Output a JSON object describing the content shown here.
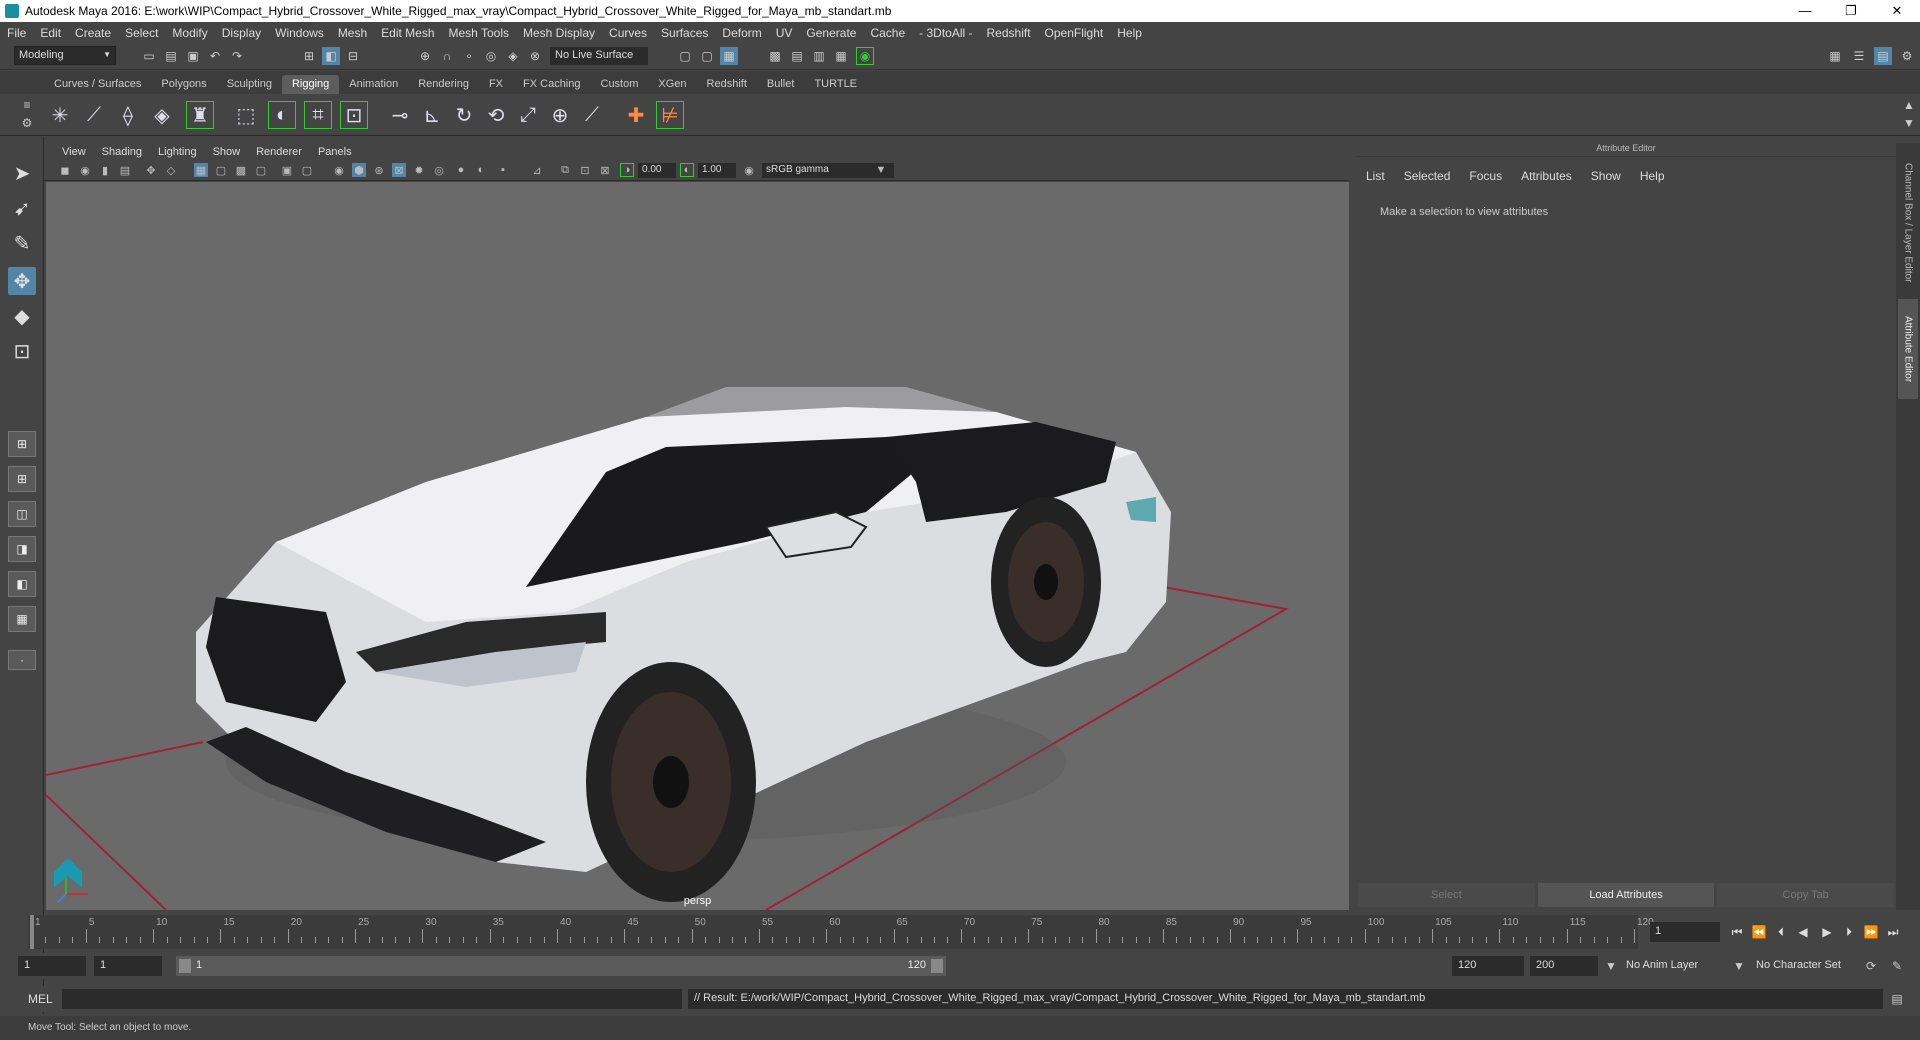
{
  "window": {
    "title": "Autodesk Maya 2016: E:\\work\\WIP\\Compact_Hybrid_Crossover_White_Rigged_max_vray\\Compact_Hybrid_Crossover_White_Rigged_for_Maya_mb_standart.mb",
    "controls": [
      "—",
      "❐",
      "✕"
    ]
  },
  "menu": [
    "File",
    "Edit",
    "Create",
    "Select",
    "Modify",
    "Display",
    "Windows",
    "Mesh",
    "Edit Mesh",
    "Mesh Tools",
    "Mesh Display",
    "Curves",
    "Surfaces",
    "Deform",
    "UV",
    "Generate",
    "Cache",
    "- 3DtoAll -",
    "Redshift",
    "OpenFlight",
    "Help"
  ],
  "status": {
    "mode": "Modeling",
    "live_surface": "No Live Surface"
  },
  "shelf_tabs": [
    "Curves / Surfaces",
    "Polygons",
    "Sculpting",
    "Rigging",
    "Animation",
    "Rendering",
    "FX",
    "FX Caching",
    "Custom",
    "XGen",
    "Redshift",
    "Bullet",
    "TURTLE"
  ],
  "shelf_active": "Rigging",
  "viewport": {
    "menu": [
      "View",
      "Shading",
      "Lighting",
      "Show",
      "Renderer",
      "Panels"
    ],
    "exposure": "0.00",
    "gamma": "1.00",
    "color_space": "sRGB gamma",
    "camera": "persp"
  },
  "attr_editor": {
    "title": "Attribute Editor",
    "menu": [
      "List",
      "Selected",
      "Focus",
      "Attributes",
      "Show",
      "Help"
    ],
    "message": "Make a selection to view attributes",
    "buttons": [
      "Select",
      "Load Attributes",
      "Copy Tab"
    ]
  },
  "side_tabs": [
    "Channel Box / Layer Editor",
    "Attribute Editor"
  ],
  "timeline": {
    "ticks": [
      "1",
      "5",
      "10",
      "15",
      "20",
      "25",
      "30",
      "35",
      "40",
      "45",
      "50",
      "55",
      "60",
      "65",
      "70",
      "75",
      "80",
      "85",
      "90",
      "95",
      "100",
      "105",
      "110",
      "115",
      "120"
    ],
    "current_frame": "1"
  },
  "range": {
    "start": "1",
    "start_inner": "1",
    "slider_start": "1",
    "slider_end": "120",
    "end_inner": "120",
    "end": "200",
    "anim_layer": "No Anim Layer",
    "char_set": "No Character Set"
  },
  "mel": {
    "label": "MEL",
    "result": "// Result: E:/work/WIP/Compact_Hybrid_Crossover_White_Rigged_max_vray/Compact_Hybrid_Crossover_White_Rigged_for_Maya_mb_standart.mb"
  },
  "help_line": "Move Tool: Select an object to move."
}
